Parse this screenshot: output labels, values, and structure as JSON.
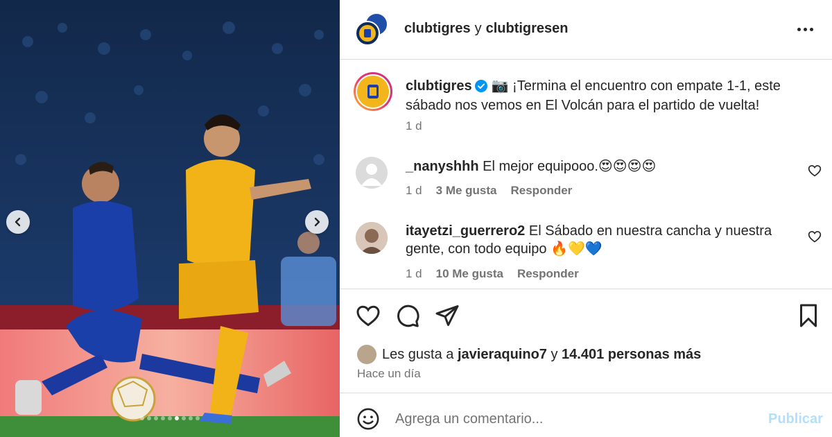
{
  "header": {
    "user1": "clubtigres",
    "joiner": "y",
    "user2": "clubtigresen"
  },
  "caption": {
    "username": "clubtigres",
    "text": "📷 ¡Termina el encuentro con empate 1-1, este sábado nos vemos en El Volcán para el partido de vuelta!",
    "time": "1 d"
  },
  "comments": [
    {
      "username": "_nanyshhh",
      "text": "El mejor equipooo.😍😍😍😍",
      "time": "1 d",
      "likes": "3 Me gusta",
      "reply": "Responder"
    },
    {
      "username": "itayetzi_guerrero2",
      "text": "El Sábado en nuestra cancha y nuestra gente, con todo equipo 🔥💛💙",
      "time": "1 d",
      "likes": "10 Me gusta",
      "reply": "Responder"
    }
  ],
  "likes": {
    "prefix": "Les gusta a",
    "user": "javieraquino7",
    "joiner": "y",
    "count": "14.401 personas más"
  },
  "posted": "Hace un día",
  "add_comment": {
    "placeholder": "Agrega un comentario...",
    "publish": "Publicar"
  },
  "colors": {
    "accent_disabled": "#b2dffc",
    "verified": "#0095f6",
    "muted": "#737373",
    "divider": "#dbdbdb"
  },
  "carousel": {
    "slides": 9,
    "active_index": 5
  }
}
